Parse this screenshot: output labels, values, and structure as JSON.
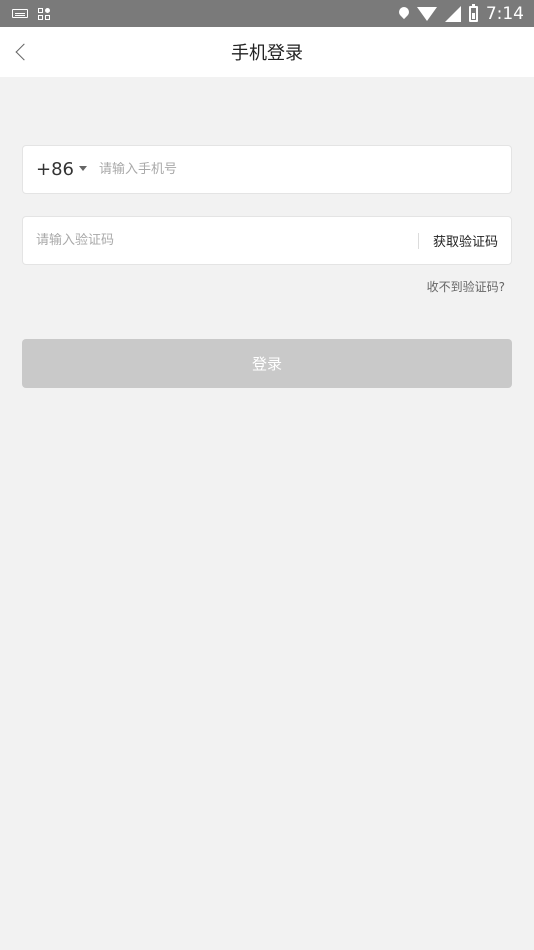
{
  "status_bar": {
    "time": "7:14"
  },
  "navbar": {
    "title": "手机登录"
  },
  "phone_field": {
    "country_code": "+86",
    "placeholder": "请输入手机号",
    "value": ""
  },
  "code_field": {
    "placeholder": "请输入验证码",
    "value": "",
    "get_code_label": "获取验证码"
  },
  "no_code_link": "收不到验证码?",
  "login_button": {
    "label": "登录",
    "color": "#c9c9c9"
  }
}
